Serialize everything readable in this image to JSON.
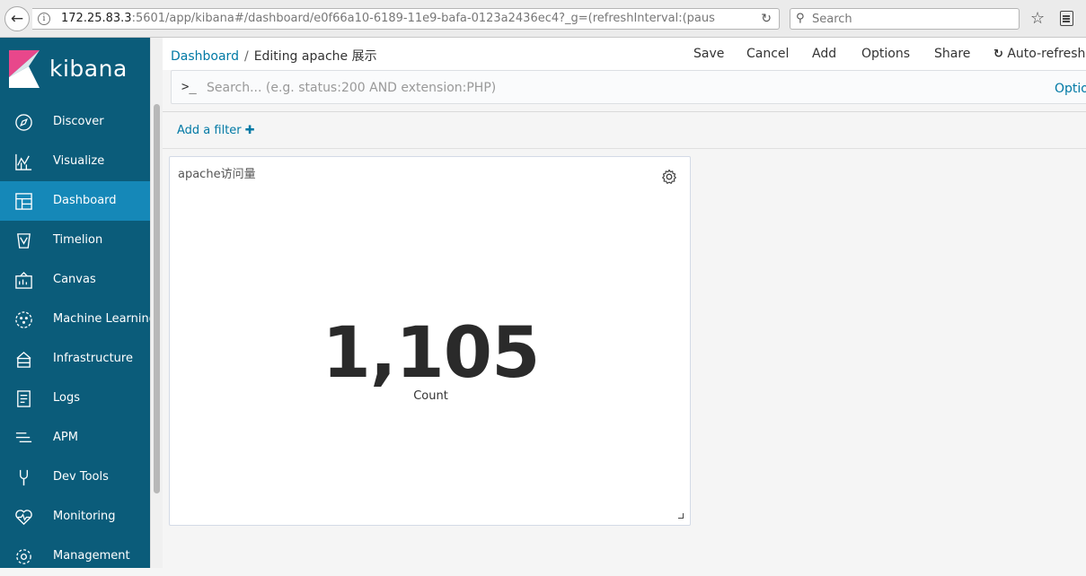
{
  "browser": {
    "url_host": "172.25.83.3",
    "url_rest": ":5601/app/kibana#/dashboard/e0f66a10-6189-11e9-bafa-0123a2436ec4?_g=(refreshInterval:(paus",
    "search_placeholder": "Search"
  },
  "sidebar": {
    "brand": "kibana",
    "items": [
      {
        "label": "Discover",
        "icon": "compass-icon"
      },
      {
        "label": "Visualize",
        "icon": "chart-icon"
      },
      {
        "label": "Dashboard",
        "icon": "dashboard-icon",
        "active": true
      },
      {
        "label": "Timelion",
        "icon": "timelion-icon"
      },
      {
        "label": "Canvas",
        "icon": "canvas-icon"
      },
      {
        "label": "Machine Learning",
        "icon": "ml-icon"
      },
      {
        "label": "Infrastructure",
        "icon": "infrastructure-icon"
      },
      {
        "label": "Logs",
        "icon": "logs-icon"
      },
      {
        "label": "APM",
        "icon": "apm-icon"
      },
      {
        "label": "Dev Tools",
        "icon": "wrench-icon"
      },
      {
        "label": "Monitoring",
        "icon": "heartbeat-icon"
      },
      {
        "label": "Management",
        "icon": "gear-icon"
      }
    ]
  },
  "topnav": {
    "breadcrumb_root": "Dashboard",
    "breadcrumb_sep": "/",
    "breadcrumb_current": "Editing apache 展示",
    "save": "Save",
    "cancel": "Cancel",
    "add": "Add",
    "options": "Options",
    "share": "Share",
    "auto_refresh": "Auto-refresh"
  },
  "query": {
    "prompt": ">_",
    "placeholder": "Search... (e.g. status:200 AND extension:PHP)",
    "options": "Options"
  },
  "filter": {
    "add_filter": "Add a filter"
  },
  "panel": {
    "title": "apache访问量",
    "metric_value": "1,105",
    "metric_label": "Count"
  },
  "colors": {
    "sidebar_bg": "#0b5c7a",
    "sidebar_active": "#1588b8",
    "link": "#0079a5"
  }
}
